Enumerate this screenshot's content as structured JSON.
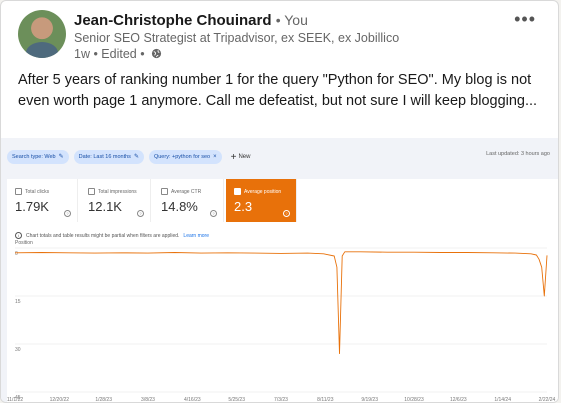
{
  "post": {
    "author": "Jean-Christophe Chouinard",
    "relation": "• You",
    "headline": "Senior SEO Strategist at Tripadvisor, ex SEEK, ex Jobillico",
    "meta": "1w • Edited •",
    "more_icon": "more-horizontal-icon",
    "text": "After 5 years of ranking number 1 for the query \"Python for SEO\". My blog is not even worth page 1 anymore. Call me defeatist, but not sure I will keep blogging..."
  },
  "gsc": {
    "filters": [
      {
        "label": "Search type: Web",
        "icon": "pencil-icon"
      },
      {
        "label": "Date: Last 16 months",
        "icon": "pencil-icon"
      },
      {
        "label": "Query: +python for seo",
        "icon": "close-icon"
      }
    ],
    "new_label": "New",
    "last_updated": "Last updated: 3 hours ago",
    "metrics": [
      {
        "label": "Total clicks",
        "value": "1.79K",
        "active": false
      },
      {
        "label": "Total impressions",
        "value": "12.1K",
        "active": false
      },
      {
        "label": "Average CTR",
        "value": "14.8%",
        "active": false
      },
      {
        "label": "Average position",
        "value": "2.3",
        "active": true
      }
    ],
    "note": "Chart totals and table results might be partial when filters are applied.",
    "note_link": "Learn more",
    "accent": "#e8710a",
    "chip_bg": "#d3e3fd"
  },
  "chart_data": {
    "type": "line",
    "ylabel": "Position",
    "y_ticks": [
      0,
      15,
      30,
      45
    ],
    "ylim": [
      0,
      45
    ],
    "y_inverted": true,
    "x_ticks": [
      "11/1/22",
      "12/20/22",
      "1/28/23",
      "3/8/23",
      "4/16/23",
      "5/25/23",
      "7/3/23",
      "8/11/23",
      "9/19/23",
      "10/28/23",
      "12/6/23",
      "1/14/24",
      "2/22/24"
    ],
    "series": [
      {
        "color": "#e8710a",
        "x": [
          0,
          0.05,
          0.1,
          0.15,
          0.2,
          0.25,
          0.3,
          0.35,
          0.4,
          0.45,
          0.5,
          0.55,
          0.58,
          0.6,
          0.605,
          0.61,
          0.615,
          0.62,
          0.65,
          0.7,
          0.75,
          0.8,
          0.85,
          0.9,
          0.94,
          0.97,
          0.98,
          0.985,
          0.99,
          0.995,
          1.0
        ],
        "values": [
          1.5,
          1.4,
          1.5,
          1.6,
          1.5,
          1.6,
          1.4,
          1.6,
          1.5,
          1.6,
          1.7,
          1.6,
          1.8,
          2.5,
          6,
          33,
          2.5,
          1.2,
          1.2,
          1.3,
          1.3,
          1.4,
          1.4,
          1.5,
          1.6,
          1.8,
          2.2,
          3.5,
          6.0,
          15.0,
          2.3
        ]
      }
    ]
  }
}
